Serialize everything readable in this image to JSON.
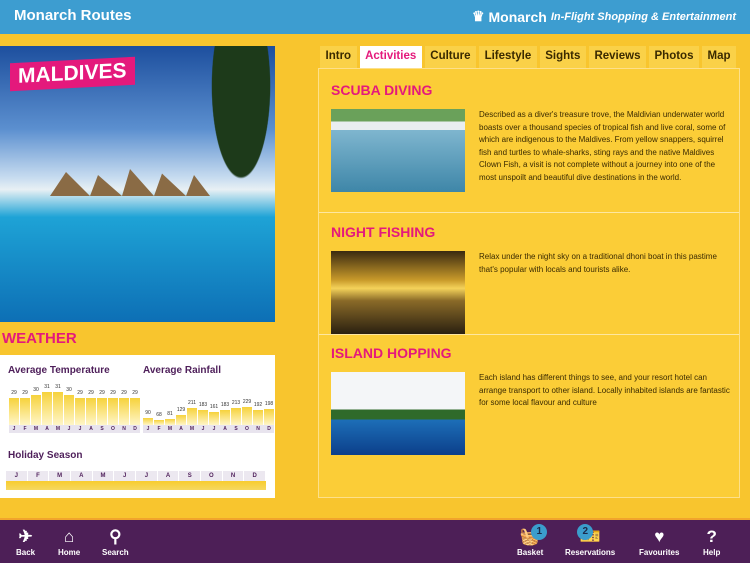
{
  "header": {
    "title": "Monarch Routes",
    "brand": "Monarch",
    "tagline": "In-Flight Shopping & Entertainment"
  },
  "hero": {
    "label": "MALDIVES"
  },
  "weather": {
    "heading": "WEATHER",
    "holiday_title": "Holiday Season"
  },
  "chart_data": [
    {
      "type": "bar",
      "title": "Average Temperature",
      "categories": [
        "J",
        "F",
        "M",
        "A",
        "M",
        "J",
        "J",
        "A",
        "S",
        "O",
        "N",
        "D"
      ],
      "values": [
        29,
        29,
        30,
        31,
        31,
        30,
        29,
        29,
        29,
        29,
        29,
        29
      ]
    },
    {
      "type": "bar",
      "title": "Average Rainfall",
      "categories": [
        "J",
        "F",
        "M",
        "A",
        "M",
        "J",
        "J",
        "A",
        "S",
        "O",
        "N",
        "D"
      ],
      "values": [
        90,
        68,
        81,
        129,
        211,
        183,
        161,
        183,
        213,
        229,
        192,
        198
      ]
    }
  ],
  "holiday_months": [
    "J",
    "F",
    "M",
    "A",
    "M",
    "J",
    "J",
    "A",
    "S",
    "O",
    "N",
    "D"
  ],
  "tabs": [
    {
      "label": "Intro"
    },
    {
      "label": "Activities",
      "active": true
    },
    {
      "label": "Culture"
    },
    {
      "label": "Lifestyle"
    },
    {
      "label": "Sights"
    },
    {
      "label": "Reviews"
    },
    {
      "label": "Photos"
    },
    {
      "label": "Map"
    }
  ],
  "sections": [
    {
      "title": "SCUBA DIVING",
      "text": "Described as a diver's treasure trove, the Maldivian underwater world boasts over a thousand species of tropical fish and live coral, some of which are indigenous to the Maldives. From yellow snappers, squirrel fish and turtles to whale-sharks, sting rays and the native Maldives Clown Fish, a visit is not complete without a journey into one of the most unspoilt and beautiful dive destinations in the world."
    },
    {
      "title": "NIGHT FISHING",
      "text": "Relax under the night sky on a traditional dhoni boat in this pastime that's popular with locals and tourists alike."
    },
    {
      "title": "ISLAND HOPPING",
      "text": "Each island has different things to see, and your resort hotel can arrange transport to other island. Locally inhabited islands are fantastic for some local flavour and culture"
    }
  ],
  "nav": {
    "back": "Back",
    "home": "Home",
    "search": "Search",
    "basket": "Basket",
    "basket_count": "1",
    "reservations": "Reservations",
    "reservations_count": "2",
    "favourites": "Favourites",
    "help": "Help"
  },
  "colors": {
    "header": "#3d9dd0",
    "accent": "#e4197c",
    "background": "#f8c52e",
    "navbar": "#4d1f57"
  }
}
